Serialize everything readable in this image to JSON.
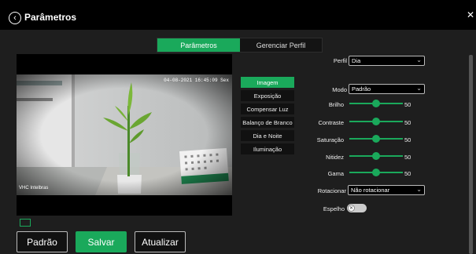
{
  "header": {
    "title": "Parâmetros",
    "close_icon": "close-icon",
    "back_icon": "chevron-left-icon"
  },
  "tabs": [
    {
      "label": "Parâmetros",
      "active": true
    },
    {
      "label": "Gerenciar Perfil",
      "active": false
    }
  ],
  "preview": {
    "timestamp": "04-08-2021 16:45:09 Sex",
    "channel_name": "VHC Intelbras"
  },
  "submenu": [
    {
      "label": "Imagem",
      "active": true
    },
    {
      "label": "Exposição",
      "active": false
    },
    {
      "label": "Compensar Luz",
      "active": false
    },
    {
      "label": "Balanço de Branco",
      "active": false
    },
    {
      "label": "Dia e Noite",
      "active": false
    },
    {
      "label": "Iluminação",
      "active": false
    }
  ],
  "settings": {
    "perfil": {
      "label": "Perfil",
      "value": "Dia"
    },
    "modo": {
      "label": "Modo",
      "value": "Padrão"
    },
    "sliders": [
      {
        "label": "Brilho",
        "value": "50"
      },
      {
        "label": "Contraste",
        "value": "50"
      },
      {
        "label": "Saturação",
        "value": "50"
      },
      {
        "label": "Nitidez",
        "value": "50"
      },
      {
        "label": "Gama",
        "value": "50"
      }
    ],
    "rotacionar": {
      "label": "Rotacionar",
      "value": "Não rotacionar"
    },
    "espelho": {
      "label": "Espelho",
      "enabled": false
    }
  },
  "buttons": {
    "default": "Padrão",
    "save": "Salvar",
    "refresh": "Atualizar"
  },
  "colors": {
    "accent": "#1aa95b",
    "background": "#1e1e1e"
  }
}
